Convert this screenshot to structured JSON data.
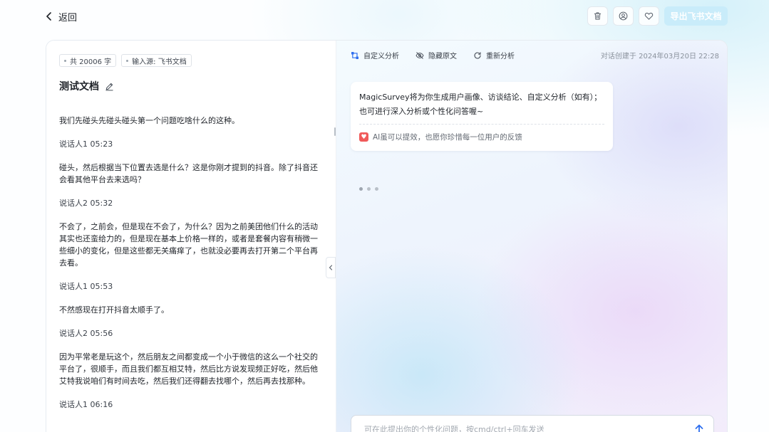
{
  "header": {
    "back_label": "返回",
    "actions": [
      {
        "name": "delete",
        "icon": "trash-icon"
      },
      {
        "name": "user",
        "icon": "user-icon"
      },
      {
        "name": "favorite",
        "icon": "heart-icon"
      }
    ],
    "export_label": "导出飞书文档"
  },
  "document": {
    "tags": [
      "共 20006 字",
      "输入源: 飞书文档"
    ],
    "title": "测试文档",
    "transcript": [
      {
        "kind": "text",
        "text": "我们先碰头先碰头碰头第一个问题吃啥什么的这种。"
      },
      {
        "kind": "speaker",
        "text": "说话人1 05:23"
      },
      {
        "kind": "text",
        "text": "碰头，然后根据当下位置去选是什么？这是你刚才提到的抖音。除了抖音还会看其他平台去来选吗？"
      },
      {
        "kind": "speaker",
        "text": "说话人2 05:32"
      },
      {
        "kind": "text",
        "text": "不会了，之前会，但是现在不会了，为什么？因为之前美团他们什么的活动其实也还蛮给力的，但是现在基本上价格一样的，或者是套餐内容有稍微一些细小的变化，但是这些都无关痛痒了，也就没必要再去打开第二个平台再去看。"
      },
      {
        "kind": "speaker",
        "text": "说话人1 05:53"
      },
      {
        "kind": "text",
        "text": "不然感现在打开抖音太顺手了。"
      },
      {
        "kind": "speaker",
        "text": "说话人2 05:56"
      },
      {
        "kind": "text",
        "text": "因为平常老是玩这个，然后朋友之间都变成一个小于微信的这么一个社交的平台了，很顺手，而且我们都互相艾特，然后比方说发现频正好吃，然后他艾特我说咱们有时间去吃，然后我们还得翻去找哪个，然后再去找那种。"
      },
      {
        "kind": "speaker",
        "text": "说话人1 06:16"
      }
    ]
  },
  "analysis": {
    "toolbar": [
      {
        "label": "自定义分析",
        "icon": "custom-analysis-icon"
      },
      {
        "label": "隐藏原文",
        "icon": "eye-off-icon"
      },
      {
        "label": "重新分析",
        "icon": "refresh-icon"
      }
    ],
    "created_at": "对话创建于 2024年03月20日 22:28",
    "message_line1": "MagicSurvey将为你生成用户画像、访谈结论、自定义分析（如有）；",
    "message_line2": "也可进行深入分析或个性化问答喔~",
    "note": "AI虽可以提效，也愿你珍惜每一位用户的反馈",
    "composer_placeholder": "可在此提出你的个性化问题，按cmd/ctrl+回车发送"
  },
  "colors": {
    "accent": "#2f6fef",
    "export_button_bg": "#c9ecfa",
    "text": "#1f2329"
  }
}
